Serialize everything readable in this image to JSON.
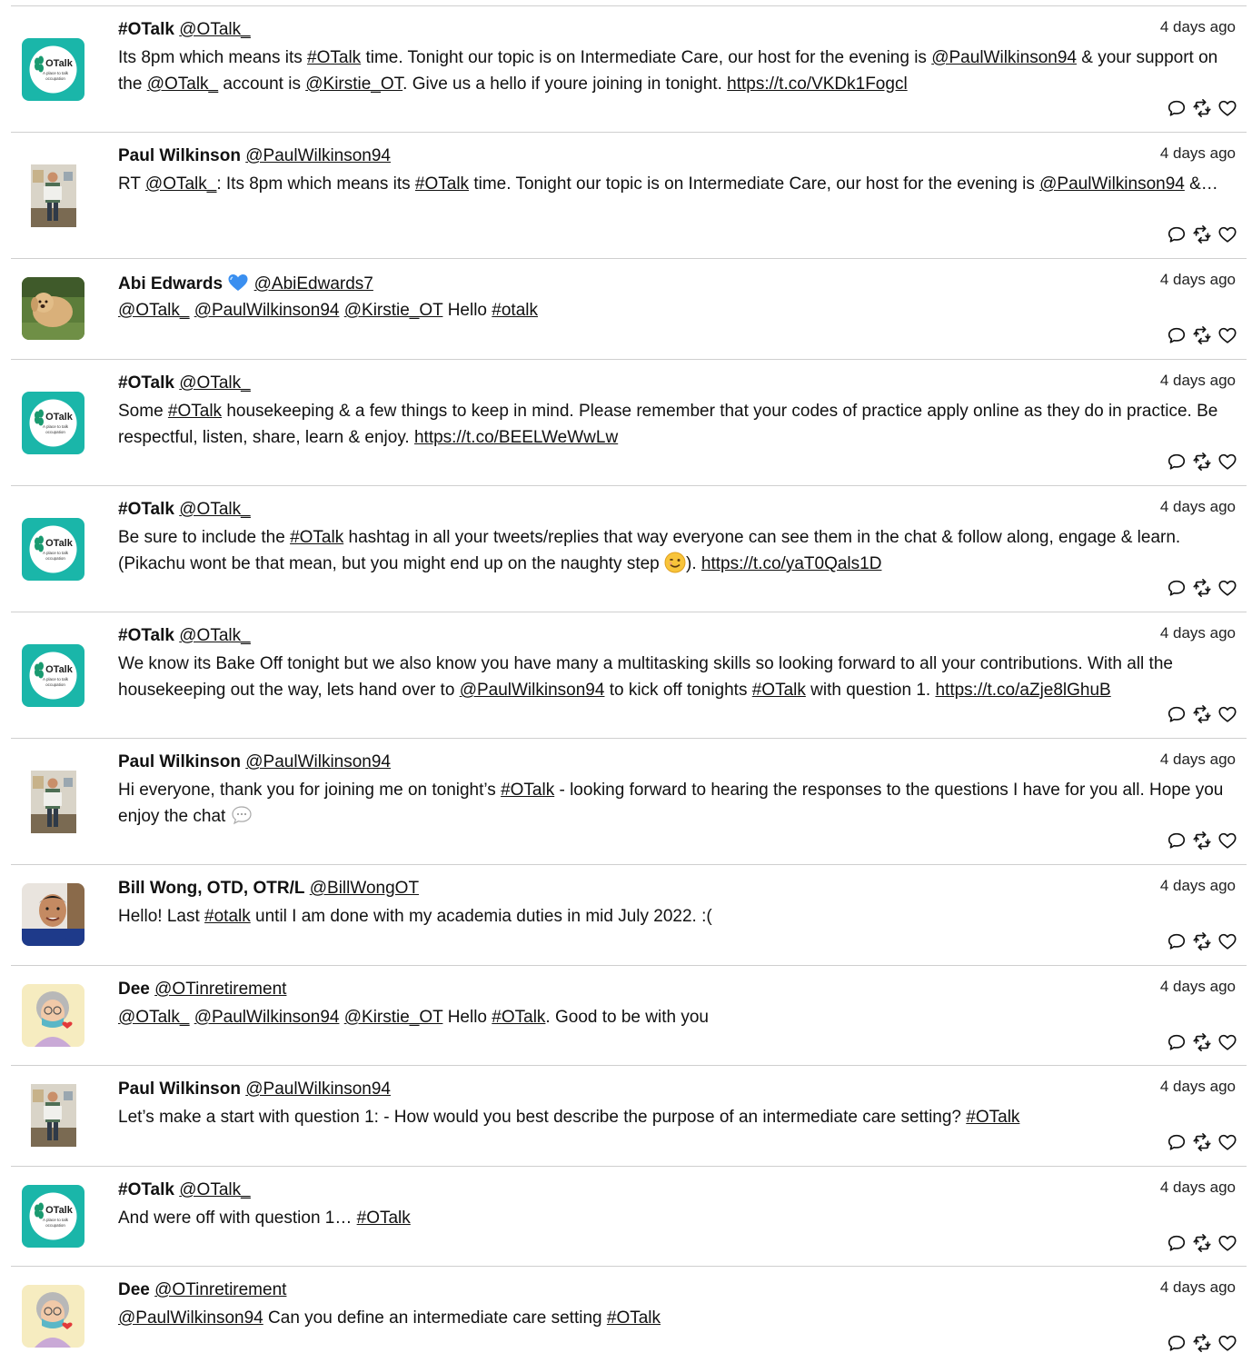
{
  "tweets": [
    {
      "name": "#OTalk",
      "handle": "@OTalk_",
      "time": "4 days ago",
      "avatar": "otalk-logo",
      "segments": [
        {
          "t": "Its 8pm which means its "
        },
        {
          "l": "#OTalk"
        },
        {
          "t": " time. Tonight our topic is on Intermediate Care, our host for the evening is "
        },
        {
          "l": "@PaulWilkinson94"
        },
        {
          "t": " & your support on the "
        },
        {
          "l": "@OTalk_"
        },
        {
          "t": " account is "
        },
        {
          "l": "@Kirstie_OT"
        },
        {
          "t": ". Give us a hello if youre joining in tonight. "
        },
        {
          "l": "https://t.co/VKDk1Fogcl"
        }
      ]
    },
    {
      "name": "Paul Wilkinson",
      "handle": "@PaulWilkinson94",
      "time": "4 days ago",
      "avatar": "paul-photo",
      "segments": [
        {
          "t": "RT "
        },
        {
          "l": "@OTalk_"
        },
        {
          "t": ": Its 8pm which means its "
        },
        {
          "l": "#OTalk"
        },
        {
          "t": " time. Tonight our topic is on Intermediate Care, our host for the evening is "
        },
        {
          "l": "@PaulWilkinson94"
        },
        {
          "t": " &…"
        }
      ]
    },
    {
      "name": "Abi Edwards",
      "name_emoji": "blue-heart",
      "handle": "@AbiEdwards7",
      "time": "4 days ago",
      "avatar": "dog-photo",
      "segments": [
        {
          "l": "@OTalk_"
        },
        {
          "t": " "
        },
        {
          "l": "@PaulWilkinson94"
        },
        {
          "t": " "
        },
        {
          "l": "@Kirstie_OT"
        },
        {
          "t": " Hello "
        },
        {
          "l": "#otalk"
        }
      ]
    },
    {
      "name": "#OTalk",
      "handle": "@OTalk_",
      "time": "4 days ago",
      "avatar": "otalk-logo",
      "segments": [
        {
          "t": "Some "
        },
        {
          "l": "#OTalk"
        },
        {
          "t": " housekeeping & a few things to keep in mind. Please remember that your codes of practice apply online as they do in practice. Be respectful, listen, share, learn & enjoy. "
        },
        {
          "l": "https://t.co/BEELWeWwLw"
        }
      ]
    },
    {
      "name": "#OTalk",
      "handle": "@OTalk_",
      "time": "4 days ago",
      "avatar": "otalk-logo",
      "segments": [
        {
          "t": "Be sure to include the "
        },
        {
          "l": "#OTalk"
        },
        {
          "t": " hashtag in all your tweets/replies that way everyone can see them in the chat & follow along, engage & learn. (Pikachu wont be that mean, but you might end up on the naughty step "
        },
        {
          "e": "wink-face"
        },
        {
          "t": "). "
        },
        {
          "l": "https://t.co/yaT0Qals1D"
        }
      ]
    },
    {
      "name": "#OTalk",
      "handle": "@OTalk_",
      "time": "4 days ago",
      "avatar": "otalk-logo",
      "segments": [
        {
          "t": "We know its Bake Off tonight but we also know you have many a multitasking skills so looking forward to all your contributions. With all the housekeeping out the way, lets hand over to "
        },
        {
          "l": "@PaulWilkinson94"
        },
        {
          "t": " to kick off tonights "
        },
        {
          "l": "#OTalk"
        },
        {
          "t": " with question 1. "
        },
        {
          "l": "https://t.co/aZje8lGhuB"
        }
      ]
    },
    {
      "name": "Paul Wilkinson",
      "handle": "@PaulWilkinson94",
      "time": "4 days ago",
      "avatar": "paul-photo",
      "segments": [
        {
          "t": "Hi everyone, thank you for joining me on tonight’s "
        },
        {
          "l": "#OTalk"
        },
        {
          "t": " - looking forward to hearing the responses to the questions I have for you all. Hope you enjoy the chat "
        },
        {
          "e": "speech-bubble"
        }
      ]
    },
    {
      "name": "Bill Wong, OTD, OTR/L",
      "handle": "@BillWongOT",
      "time": "4 days ago",
      "avatar": "bill-photo",
      "segments": [
        {
          "t": "Hello! Last "
        },
        {
          "l": "#otalk"
        },
        {
          "t": " until I am done with my academia duties in mid July 2022. :("
        }
      ]
    },
    {
      "name": "Dee",
      "handle": "@OTinretirement",
      "time": "4 days ago",
      "avatar": "dee-avatar",
      "segments": [
        {
          "l": "@OTalk_"
        },
        {
          "t": " "
        },
        {
          "l": "@PaulWilkinson94"
        },
        {
          "t": " "
        },
        {
          "l": "@Kirstie_OT"
        },
        {
          "t": " Hello "
        },
        {
          "l": "#OTalk"
        },
        {
          "t": ". Good to be with you"
        }
      ]
    },
    {
      "name": "Paul Wilkinson",
      "handle": "@PaulWilkinson94",
      "time": "4 days ago",
      "avatar": "paul-photo",
      "segments": [
        {
          "t": "Let’s make a start with question 1: - How would you best describe the purpose of an intermediate care setting? "
        },
        {
          "l": "#OTalk"
        }
      ]
    },
    {
      "name": "#OTalk",
      "handle": "@OTalk_",
      "time": "4 days ago",
      "avatar": "otalk-logo",
      "segments": [
        {
          "t": "And were off with question 1… "
        },
        {
          "l": "#OTalk"
        }
      ]
    },
    {
      "name": "Dee",
      "handle": "@OTinretirement",
      "time": "4 days ago",
      "avatar": "dee-avatar",
      "segments": [
        {
          "l": "@PaulWilkinson94"
        },
        {
          "t": " Can you define an intermediate care setting "
        },
        {
          "l": "#OTalk"
        }
      ]
    }
  ],
  "logo_text": {
    "title": "OTalk",
    "tagline": "A place to talk occupation"
  },
  "action_icons": [
    "reply-icon",
    "retweet-icon",
    "like-icon"
  ],
  "colors": {
    "otalk_teal": "#1ab6a9",
    "text": "#111111",
    "divider": "#cfcfcf"
  }
}
